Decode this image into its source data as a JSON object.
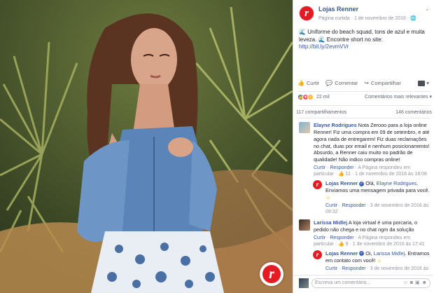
{
  "post": {
    "page_name": "Lojas Renner",
    "meta": "Página curtida · 1 de novembro de 2016 · ",
    "globe": "🌐",
    "text": "Uniforme do beach squad, tons de azul e muita leveza. ",
    "text2": "Encontre short no site:",
    "link": "http://bit.ly/2evmVVr",
    "wave": "🌊",
    "badge_letter": "r"
  },
  "actions": {
    "like": "Curtir",
    "comment": "Comentar",
    "share": "Compartilhar"
  },
  "reactions": {
    "count": "22 mil",
    "sort": "Comentários mais relevantes ▾"
  },
  "counts": {
    "shares": "117 compartilhamentos",
    "comments": "146 comentários"
  },
  "comments": [
    {
      "name": "Elayne Rodrigues",
      "text": "Nota Zerooo para a loja online Renner! Fiz uma compra em 09 de setembro, e até agora nada de entregarem! Fiz duas reclamações no chat, duas por email e nenhum posicionamento! Absurdo, a Renner caiu muito no padrão de qualidade! Não indico compras online!",
      "meta_links": "Curtir · Responder",
      "meta_rest": " · A Página respondeu em particular · 👍 11 · 1 de novembro de 2016 às 18:08"
    },
    {
      "name": "Lojas Renner",
      "tag": "Elayne Rodrigues",
      "text_pre": "Olá, ",
      "text_post": ". Enviamos uma mensagem privada para você. ",
      "emoji": "☺",
      "meta_links": "Curtir · Responder",
      "meta_rest": " · 3 de novembro de 2016 às 09:32"
    },
    {
      "name": "Larissa Midlej",
      "text": "A loja virtual é uma porcaria, o pedido não chega e no chat ngm da solução",
      "meta_links": "Curtir · Responder",
      "meta_rest": " · A Página respondeu em particular · 👍 9 · 1 de novembro de 2016 às 17:41"
    },
    {
      "name": "Lojas Renner",
      "tag": "Larissa Midlej",
      "text_pre": "Oi, ",
      "text_post": ". Entramos em contato com você! ",
      "emoji": "☺",
      "meta_links": "Curtir · Responder",
      "meta_rest": " · 3 de novembro de 2016 às"
    }
  ],
  "comment_box": {
    "placeholder": "Escreva um comentário..."
  }
}
